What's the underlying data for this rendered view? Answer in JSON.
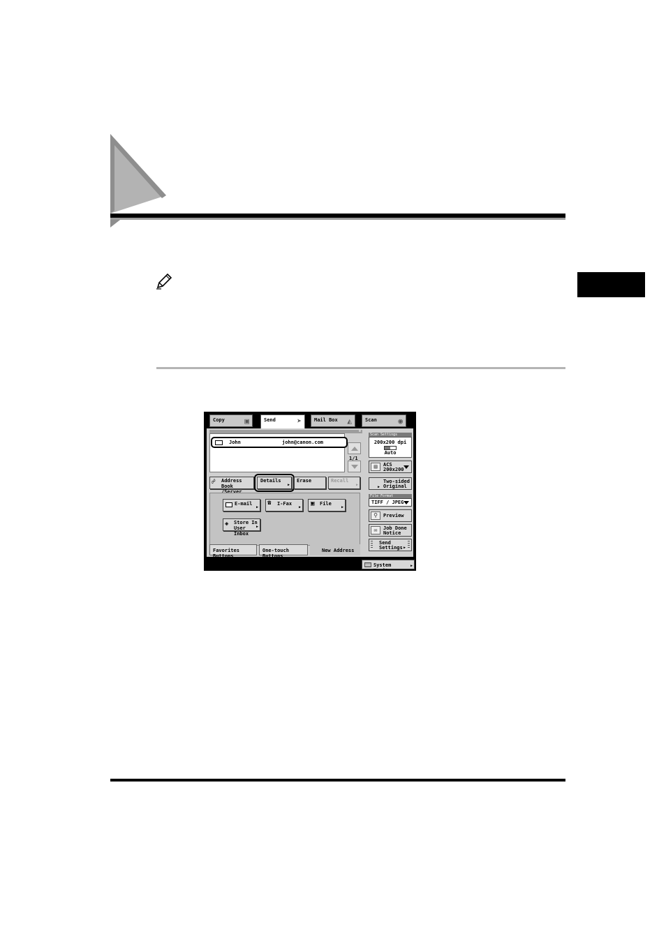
{
  "panel": {
    "tabs": [
      {
        "label": "Copy",
        "icon": "copy-icon"
      },
      {
        "label": "Send",
        "icon": "send-icon"
      },
      {
        "label": "Mail Box",
        "icon": "mailbox-icon"
      },
      {
        "label": "Scan",
        "icon": "scan-icon"
      }
    ],
    "active_tab": "Send",
    "destination": {
      "name": "John",
      "address": "john@canon.com"
    },
    "page_count": "1/1",
    "actions": {
      "address_book": "Address Book /Server",
      "details": "Details",
      "erase": "Erase",
      "recall": "Recall"
    },
    "types": {
      "email": "E-mail",
      "ifax": "I-Fax",
      "file": "File",
      "store": "Store In User Inbox"
    },
    "bottom_tabs": {
      "favorites": "Favorites Buttons",
      "one_touch": "One-touch Buttons",
      "new_address": "New Address"
    },
    "scan_settings": {
      "header": "Scan Settings",
      "resolution": "200x200 dpi",
      "density": "Auto",
      "size_label": "ACS 200x200",
      "two_sided": "Two-sided Original"
    },
    "file_format": {
      "header": "File Format",
      "value": "TIFF / JPEG"
    },
    "preview": "Preview",
    "job_done": "Job Done Notice",
    "send_settings": "Send Settings",
    "system_monitor": "System Monitor"
  },
  "colors": {
    "panel_background": "#cfcfcf",
    "frame": "#000000",
    "highlight_ring": "#000000"
  }
}
